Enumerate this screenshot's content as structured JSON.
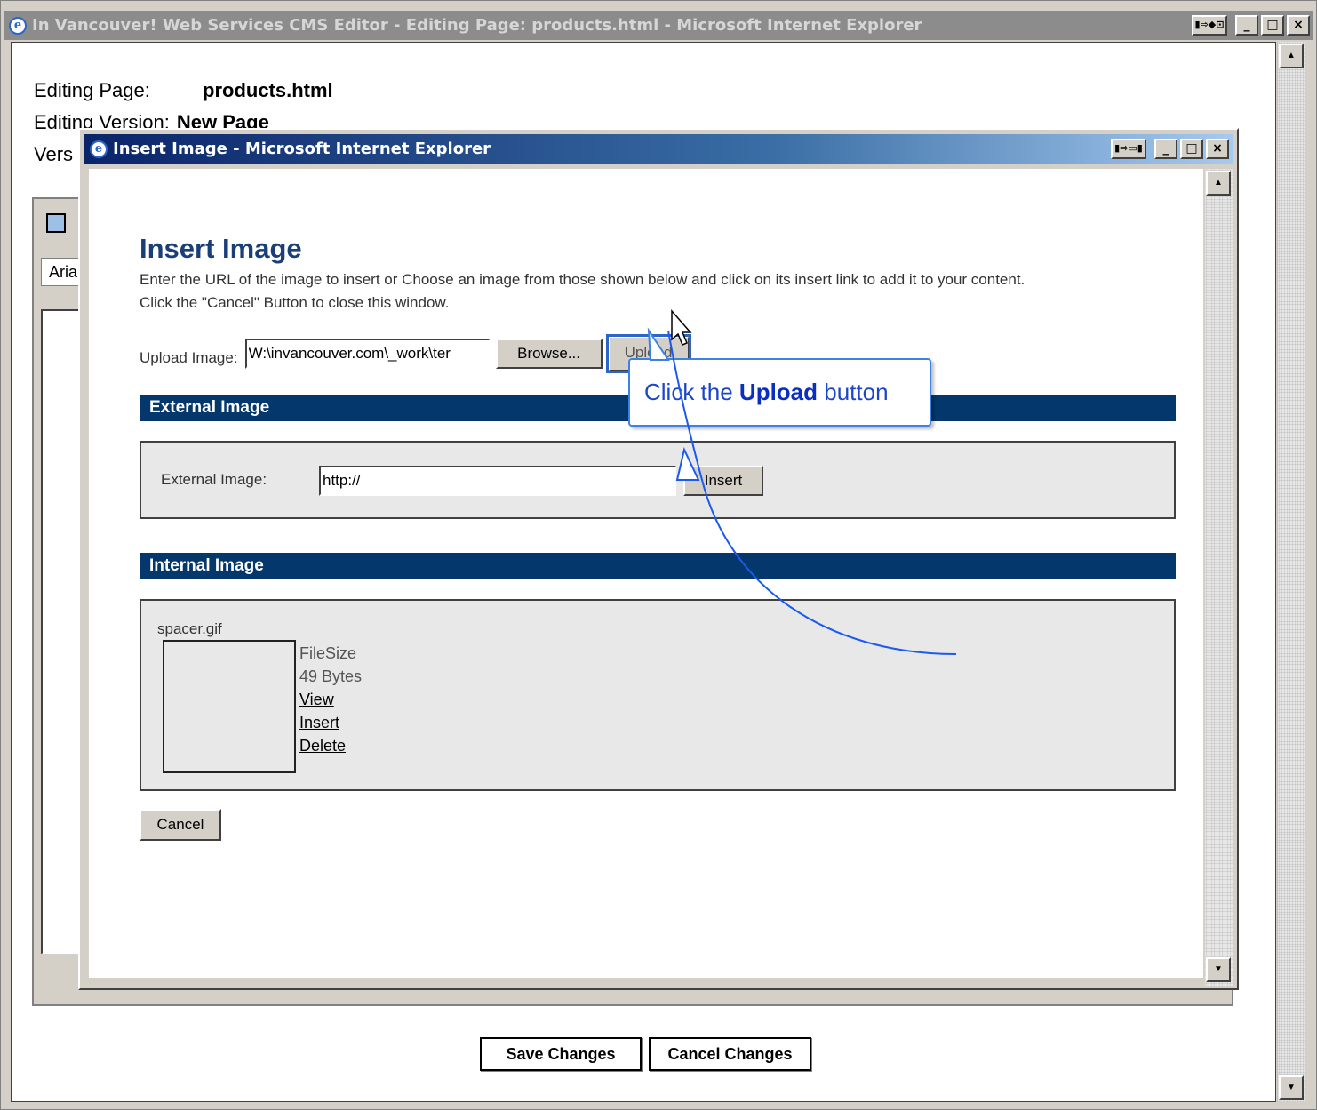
{
  "outer_window": {
    "title": "In Vancouver! Web Services CMS Editor - Editing Page: products.html - Microsoft Internet Explorer",
    "controls": {
      "extra": "▮⇨◆⊡",
      "minimize": "_",
      "maximize": "□",
      "close": "×"
    }
  },
  "editing_info": {
    "page_label": "Editing Page:",
    "page_value": "products.html",
    "version_label": "Editing Version:",
    "version_value": "New Page",
    "third_label_visible": "Vers"
  },
  "editor": {
    "font_select_value": "Arial"
  },
  "footer_buttons": {
    "save": "Save Changes",
    "cancel": "Cancel Changes"
  },
  "dialog": {
    "title": "Insert Image - Microsoft Internet Explorer",
    "controls": {
      "extra": "▮⇨▭▮",
      "minimize": "_",
      "maximize": "□",
      "close": "×"
    },
    "heading": "Insert Image",
    "description_line1": "Enter the URL of the image to insert or Choose an image from those shown below and click on its insert link to add it to your content.",
    "description_line2": "Click the \"Cancel\" Button to close this window.",
    "upload": {
      "label": "Upload Image:",
      "value": "W:\\invancouver.com\\_work\\ter",
      "browse_label": "Browse...",
      "upload_label": "Upload"
    },
    "external_section": {
      "title": "External Image",
      "label": "External Image:",
      "value": "http://",
      "insert_label": "Insert"
    },
    "internal_section": {
      "title": "Internal Image",
      "file": {
        "name": "spacer.gif",
        "size_label": "FileSize",
        "size_value": "49 Bytes",
        "view_link": "View",
        "insert_link": "Insert",
        "delete_link": "Delete"
      }
    },
    "cancel_label": "Cancel"
  },
  "callout": {
    "prefix": "Click the ",
    "emphasis": "Upload",
    "suffix": " button"
  },
  "colors": {
    "dialog_title_start": "#0a246a",
    "section_bar": "#04376c",
    "heading": "#1a3f78",
    "callout_border": "#3c82e6",
    "annotation_arrow": "#1a5af0"
  },
  "icons": {
    "ie_icon": "ie-logo-icon",
    "scroll_up": "scroll-up-arrow-icon",
    "scroll_down": "scroll-down-arrow-icon",
    "cursor": "hand-pointer-icon",
    "annotation_arrow": "curved-arrow-icon"
  }
}
